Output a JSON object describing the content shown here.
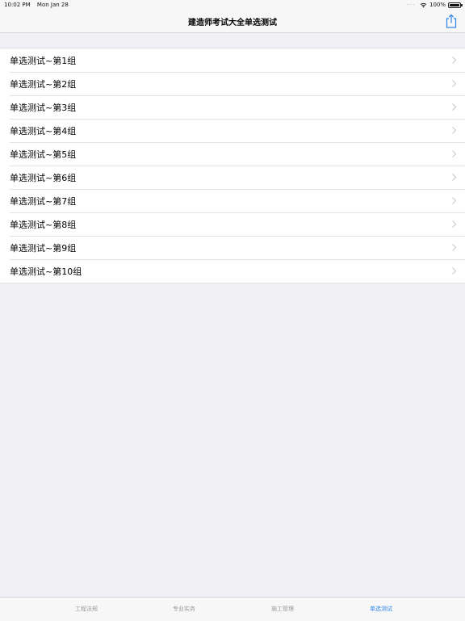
{
  "status_bar": {
    "time": "10:02 PM",
    "date": "Mon Jan 28",
    "battery": "100%",
    "dots": "····"
  },
  "nav": {
    "title": "建造师考试大全单选测试",
    "share_icon": "share-icon"
  },
  "list": {
    "items": [
      {
        "label": "单选测试~第1组"
      },
      {
        "label": "单选测试~第2组"
      },
      {
        "label": "单选测试~第3组"
      },
      {
        "label": "单选测试~第4组"
      },
      {
        "label": "单选测试~第5组"
      },
      {
        "label": "单选测试~第6组"
      },
      {
        "label": "单选测试~第7组"
      },
      {
        "label": "单选测试~第8组"
      },
      {
        "label": "单选测试~第9组"
      },
      {
        "label": "单选测试~第10组"
      }
    ]
  },
  "tabs": [
    {
      "label": "工程法规",
      "active": false
    },
    {
      "label": "专业实务",
      "active": false
    },
    {
      "label": "施工管理",
      "active": false
    },
    {
      "label": "单选测试",
      "active": true
    }
  ],
  "colors": {
    "accent": "#2f86e6",
    "background": "#efeff4",
    "tab_inactive": "#999999"
  }
}
